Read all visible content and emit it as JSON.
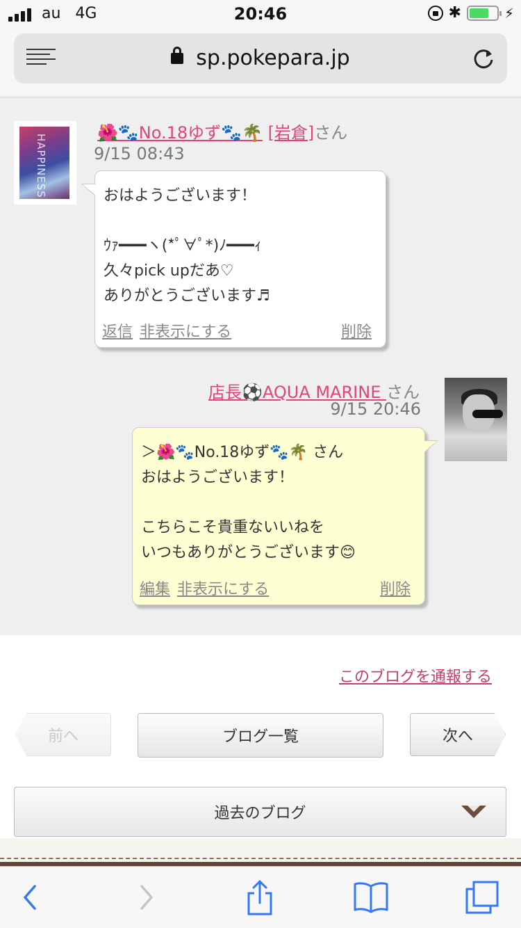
{
  "status_bar": {
    "carrier": "au",
    "network": "4G",
    "time": "20:46"
  },
  "browser": {
    "url": "sp.pokepara.jp"
  },
  "comments": [
    {
      "author_name": "🌺🐾No.18ゆず🐾🌴",
      "author_store": "[岩倉]",
      "suffix": "さん",
      "date": "9/15 08:43",
      "avatar_text": "HAPPINESS",
      "message": "おはようございます！\n\nｳｧ━━━ヽ(*ﾟ∀ﾟ*)ﾉ━━━ｨ\n久々pick upだあ♡\nありがとうございます♬",
      "actions": {
        "reply": "返信",
        "hide": "非表示にする",
        "delete": "削除"
      }
    },
    {
      "author_name": "店長⚽AQUA MARINE ",
      "suffix": "さん",
      "date": "9/15 20:46",
      "message": "＞🌺🐾No.18ゆず🐾🌴 さん\nおはようございます！\n\nこちらこそ貴重ないいねを\nいつもありがとうございます😊",
      "actions": {
        "edit": "編集",
        "hide": "非表示にする",
        "delete": "削除"
      }
    }
  ],
  "report_link": "このブログを通報する",
  "nav": {
    "prev": "前へ",
    "list": "ブログ一覧",
    "next": "次へ"
  },
  "past_blog": "過去のブログ",
  "colors": {
    "accent_pink": "#e0447a",
    "bubble_yellow": "#ffffd4",
    "footer_brown": "#5e4636",
    "ios_blue": "#3478f6"
  }
}
